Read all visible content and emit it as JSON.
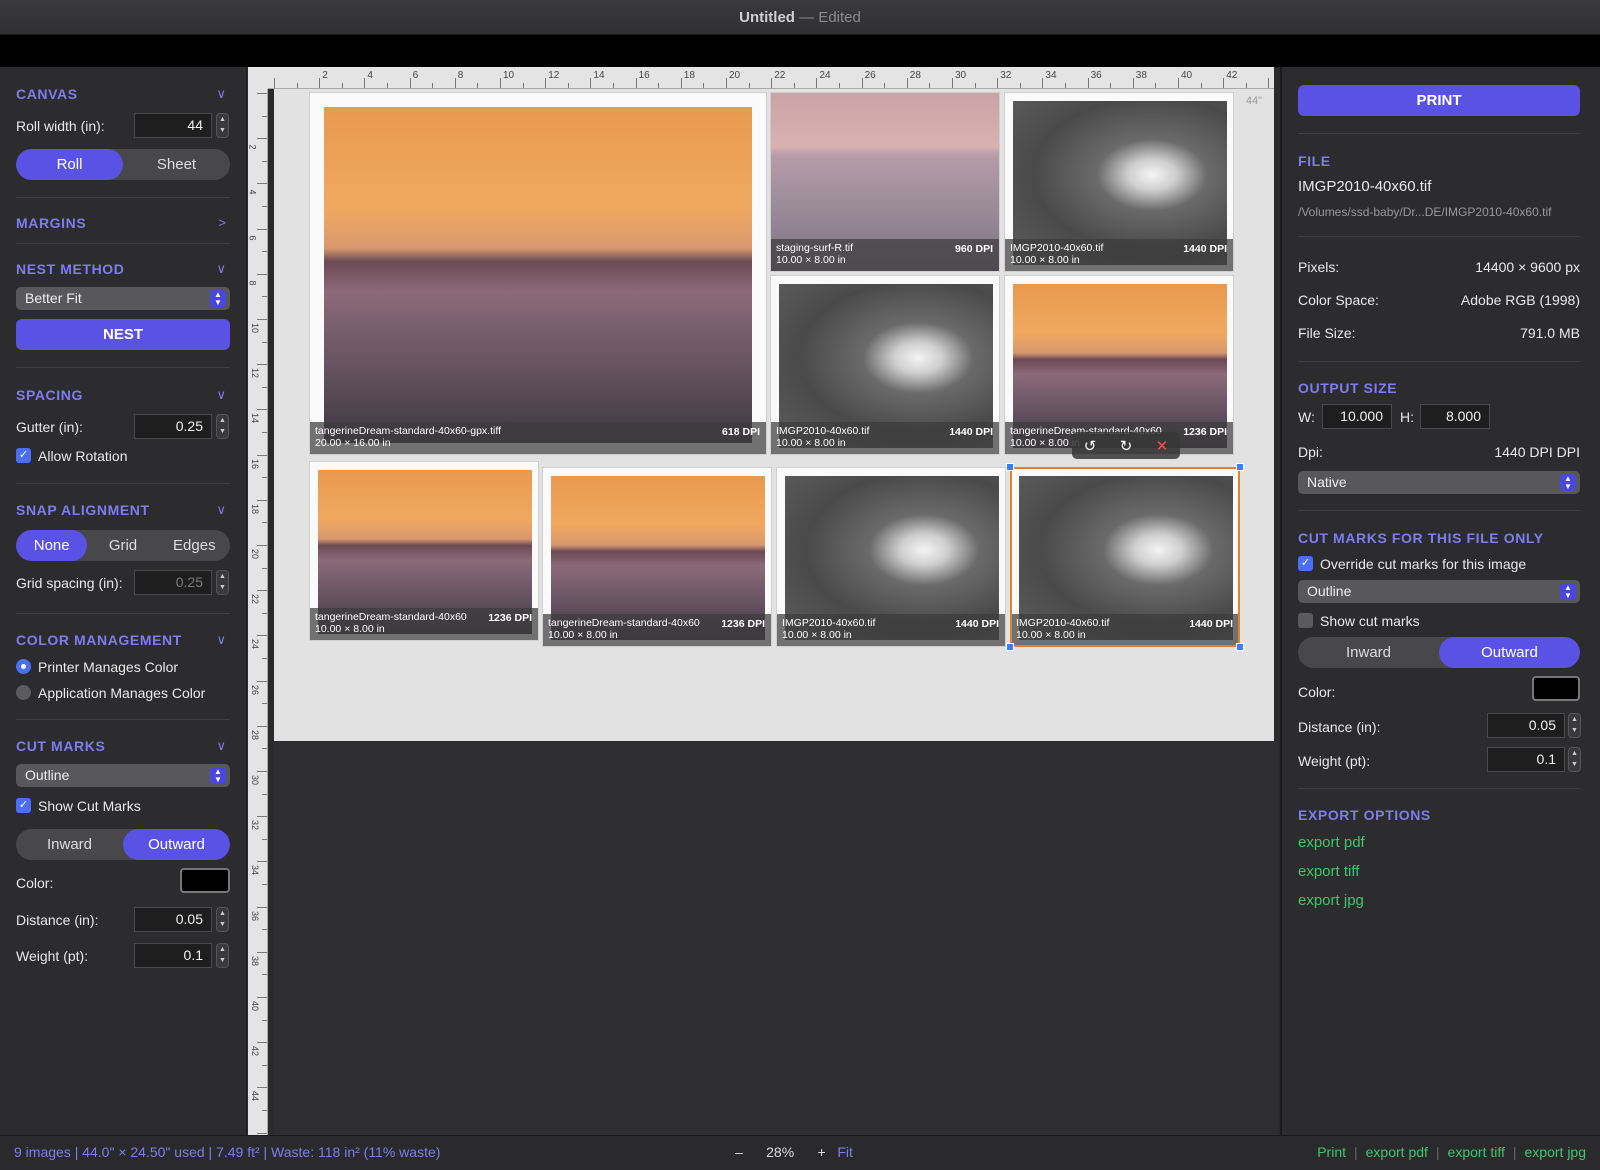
{
  "window": {
    "title": "Untitled",
    "state": "— Edited"
  },
  "left": {
    "canvas": {
      "header": "CANVAS",
      "roll_width_label": "Roll width (in):",
      "roll_width": "44",
      "modes": [
        "Roll",
        "Sheet"
      ]
    },
    "margins": {
      "header": "MARGINS"
    },
    "nest": {
      "header": "NEST METHOD",
      "method": "Better Fit",
      "button": "NEST"
    },
    "spacing": {
      "header": "SPACING",
      "gutter_label": "Gutter (in):",
      "gutter": "0.25",
      "allow_rotation": "Allow Rotation"
    },
    "snap": {
      "header": "SNAP ALIGNMENT",
      "modes": [
        "None",
        "Grid",
        "Edges"
      ],
      "grid_spacing_label": "Grid spacing (in):",
      "grid_spacing": "0.25"
    },
    "color": {
      "header": "COLOR MANAGEMENT",
      "printer": "Printer Manages Color",
      "application": "Application Manages Color"
    },
    "cut": {
      "header": "CUT MARKS",
      "style": "Outline",
      "show": "Show Cut Marks",
      "dir": [
        "Inward",
        "Outward"
      ],
      "color_label": "Color:",
      "distance_label": "Distance (in):",
      "distance": "0.05",
      "weight_label": "Weight (pt):",
      "weight": "0.1"
    }
  },
  "ruler": {
    "top": [
      "2",
      "4",
      "6",
      "8",
      "10",
      "12",
      "14",
      "16",
      "18",
      "20",
      "22",
      "24",
      "26",
      "28",
      "30",
      "32",
      "34",
      "36",
      "38",
      "40",
      "42"
    ],
    "left": [
      "2",
      "4",
      "6",
      "8",
      "10",
      "12",
      "14",
      "16",
      "18",
      "20",
      "22",
      "24",
      "26",
      "28",
      "30",
      "32",
      "34",
      "36",
      "38",
      "40",
      "42",
      "44"
    ],
    "width_label": "44\""
  },
  "tiles": [
    {
      "name": "tangerineDream-standard-40x60-gpx.tiff",
      "size": "20.00 × 16.00 in",
      "dpi": "618 DPI"
    },
    {
      "name": "staging-surf-R.tif",
      "size": "10.00 × 8.00 in",
      "dpi": "960 DPI"
    },
    {
      "name": "IMGP2010-40x60.tif",
      "size": "10.00 × 8.00 in",
      "dpi": "1440 DPI"
    },
    {
      "name": "IMGP2010-40x60.tif",
      "size": "10.00 × 8.00 in",
      "dpi": "1440 DPI"
    },
    {
      "name": "tangerineDream-standard-40x60",
      "size": "10.00 × 8.00 in",
      "dpi": "1236 DPI"
    },
    {
      "name": "tangerineDream-standard-40x60",
      "size": "10.00 × 8.00 in",
      "dpi": "1236 DPI"
    },
    {
      "name": "tangerineDream-standard-40x60",
      "size": "10.00 × 8.00 in",
      "dpi": "1236 DPI"
    },
    {
      "name": "IMGP2010-40x60.tif",
      "size": "10.00 × 8.00 in",
      "dpi": "1440 DPI"
    },
    {
      "name": "IMGP2010-40x60.tif",
      "size": "10.00 × 8.00 in",
      "dpi": "1440 DPI"
    }
  ],
  "right": {
    "print": "PRINT",
    "file": {
      "header": "FILE",
      "name": "IMGP2010-40x60.tif",
      "path": "/Volumes/ssd-baby/Dr...DE/IMGP2010-40x60.tif"
    },
    "info": {
      "pixels_label": "Pixels:",
      "pixels": "14400 × 9600 px",
      "cs_label": "Color Space:",
      "cs": "Adobe RGB (1998)",
      "fs_label": "File Size:",
      "fs": "791.0 MB"
    },
    "output": {
      "header": "OUTPUT SIZE",
      "w_label": "W:",
      "w": "10.000",
      "h_label": "H:",
      "h": "8.000",
      "dpi_label": "Dpi:",
      "dpi": "1440 DPI DPI",
      "mode": "Native"
    },
    "cut": {
      "header": "CUT MARKS FOR THIS FILE ONLY",
      "override": "Override cut marks for this image",
      "style": "Outline",
      "show": "Show cut marks",
      "dir": [
        "Inward",
        "Outward"
      ],
      "color_label": "Color:",
      "distance_label": "Distance (in):",
      "distance": "0.05",
      "weight_label": "Weight (pt):",
      "weight": "0.1"
    },
    "export": {
      "header": "EXPORT OPTIONS",
      "pdf": "export pdf",
      "tiff": "export tiff",
      "jpg": "export jpg"
    }
  },
  "status": {
    "summary": "9 images  |  44.0\" × 24.50\" used  |  7.49 ft²  |  Waste: 118 in²  (11% waste)",
    "zoom": "28%",
    "minus": "–",
    "plus": "+",
    "fit": "Fit",
    "print": "Print",
    "pdf": "export pdf",
    "tiff": "export tiff",
    "jpg": "export jpg",
    "sep": "|"
  }
}
